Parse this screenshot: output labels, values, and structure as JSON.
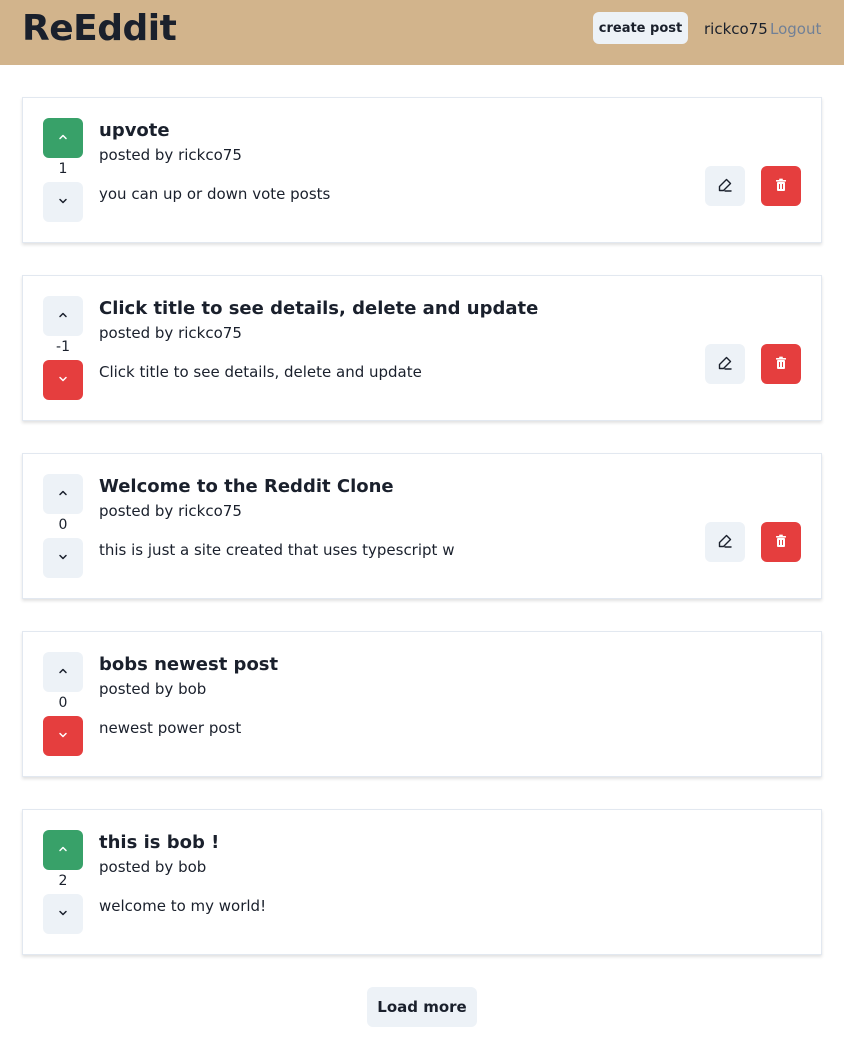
{
  "header": {
    "logo": "ReEddit",
    "create_post_label": "create post",
    "username": "rickco75",
    "logout_label": "Logout"
  },
  "colors": {
    "navbar": "#d2b48c",
    "upvoted": "#38a169",
    "downvoted": "#e53e3e",
    "neutral_button": "#edf2f7",
    "delete_button": "#e53e3e"
  },
  "icons": {
    "upvote": "chevron-up-icon",
    "downvote": "chevron-down-icon",
    "edit": "edit-icon",
    "delete": "trash-icon"
  },
  "posts": [
    {
      "title": "upvote",
      "posted_by": "posted by rickco75",
      "snippet": "you can up or down vote posts",
      "score": "1",
      "vote_status": "up",
      "can_edit": true
    },
    {
      "title": "Click title to see details, delete and update",
      "posted_by": "posted by rickco75",
      "snippet": "Click title to see details, delete and update",
      "score": "-1",
      "vote_status": "down",
      "can_edit": true
    },
    {
      "title": "Welcome to the Reddit Clone",
      "posted_by": "posted by rickco75",
      "snippet": "this is just a site created that uses typescript w",
      "score": "0",
      "vote_status": "none",
      "can_edit": true
    },
    {
      "title": "bobs newest post",
      "posted_by": "posted by bob",
      "snippet": "newest power post",
      "score": "0",
      "vote_status": "down",
      "can_edit": false
    },
    {
      "title": "this is bob !",
      "posted_by": "posted by bob",
      "snippet": "welcome to my world!",
      "score": "2",
      "vote_status": "up",
      "can_edit": false
    }
  ],
  "load_more_label": "Load more"
}
